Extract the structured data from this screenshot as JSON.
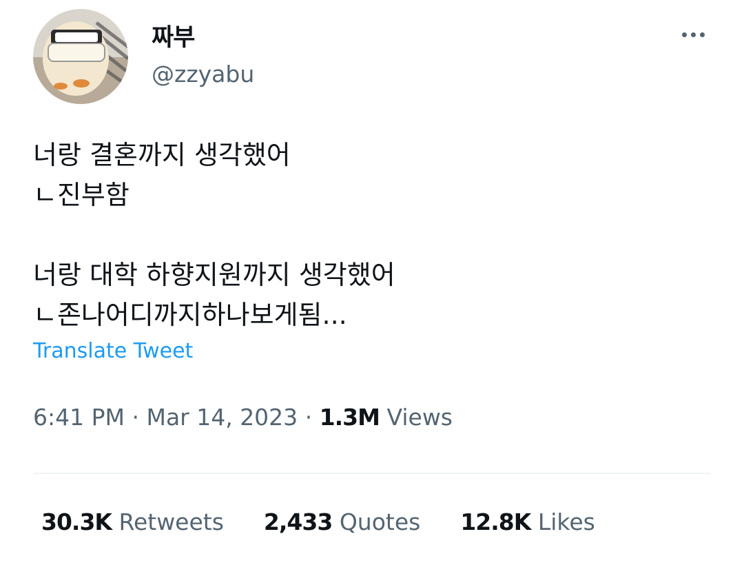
{
  "author": {
    "display_name": "짜부",
    "handle": "@zzyabu"
  },
  "more_icon": "more-horizontal-icon",
  "tweet_text": {
    "line1": "너랑 결혼까지 생각했어",
    "line2": "ㄴ진부함",
    "line3": "너랑 대학 하향지원까지 생각했어",
    "line4": "ㄴ존나어디까지하나보게됨..."
  },
  "translate_label": "Translate Tweet",
  "meta": {
    "time": "6:41 PM",
    "separator": "·",
    "date": "Mar 14, 2023",
    "views_count": "1.3M",
    "views_label": "Views"
  },
  "stats": {
    "retweets_count": "30.3K",
    "retweets_label": "Retweets",
    "quotes_count": "2,433",
    "quotes_label": "Quotes",
    "likes_count": "12.8K",
    "likes_label": "Likes"
  },
  "colors": {
    "link": "#1d9bf0",
    "secondary_text": "#536471",
    "primary_text": "#0f1419",
    "divider": "#eff3f4"
  }
}
